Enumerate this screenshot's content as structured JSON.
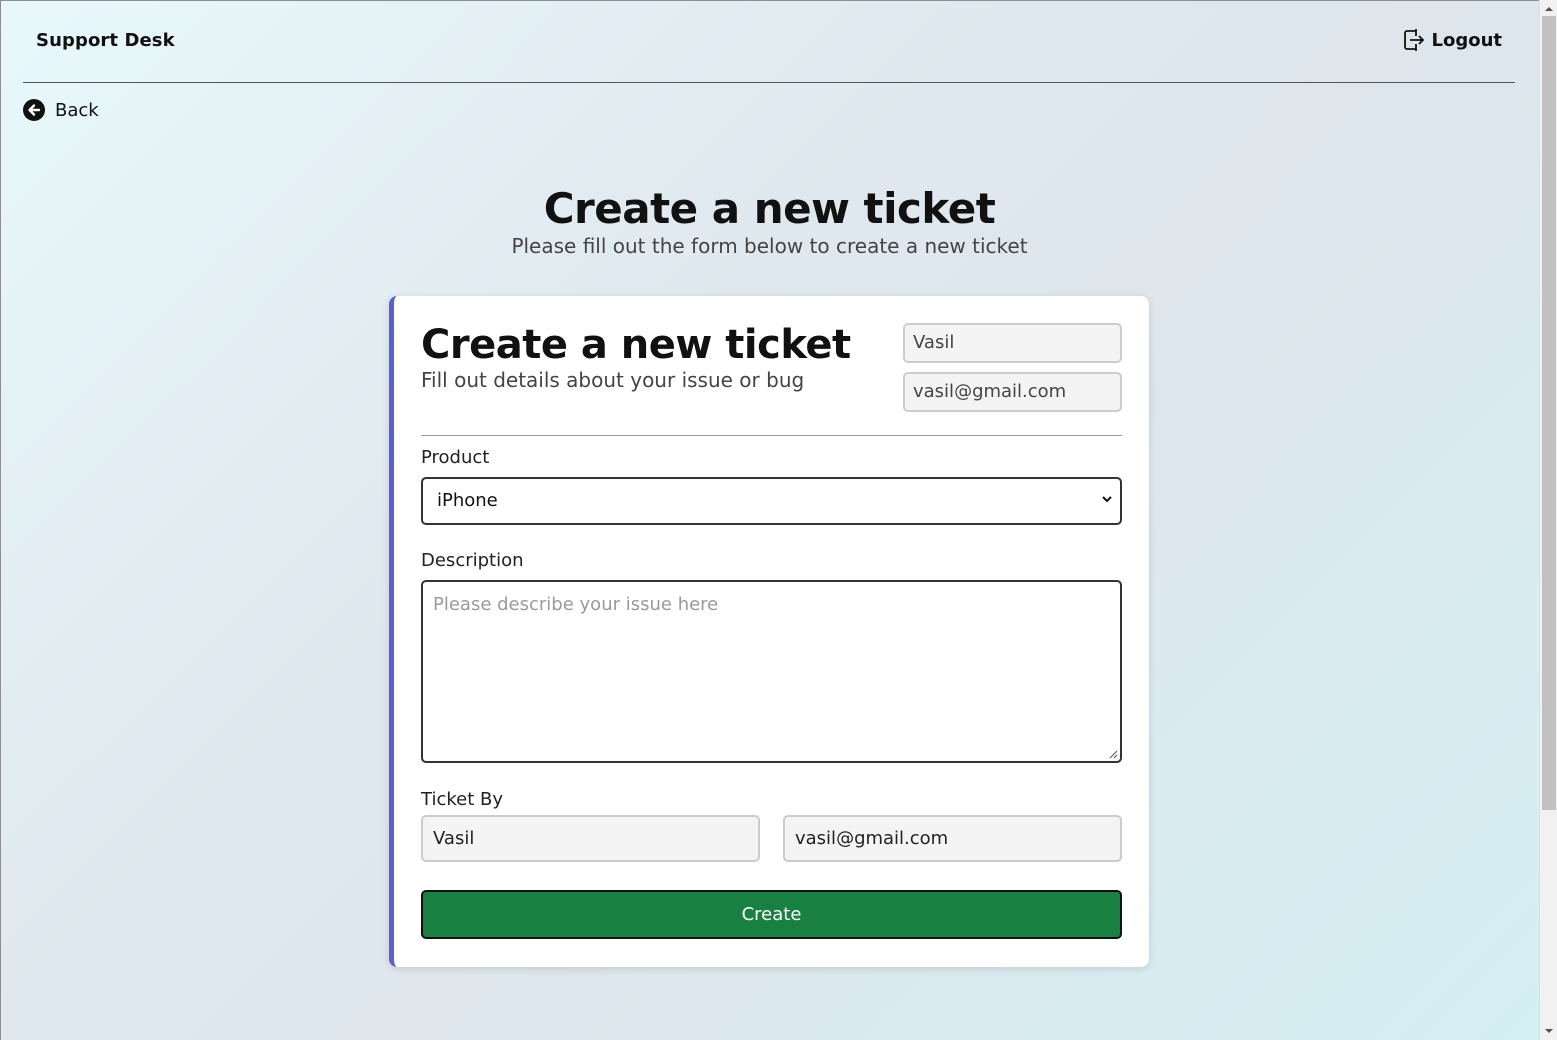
{
  "header": {
    "brand": "Support Desk",
    "logout_label": "Logout"
  },
  "nav": {
    "back_label": "Back"
  },
  "page": {
    "title": "Create a new ticket",
    "subtitle": "Please fill out the form below to create a new ticket"
  },
  "card": {
    "title": "Create a new ticket",
    "subtitle": "Fill out details about your issue or bug",
    "user_name": "Vasil",
    "user_email": "vasil@gmail.com",
    "product_label": "Product",
    "product_value": "iPhone",
    "description_label": "Description",
    "description_placeholder": "Please describe your issue here",
    "ticket_by_label": "Ticket By",
    "ticket_by_name": "Vasil",
    "ticket_by_email": "vasil@gmail.com",
    "create_label": "Create"
  },
  "colors": {
    "accent_border": "#5c5fd4",
    "create_button": "#188040"
  }
}
